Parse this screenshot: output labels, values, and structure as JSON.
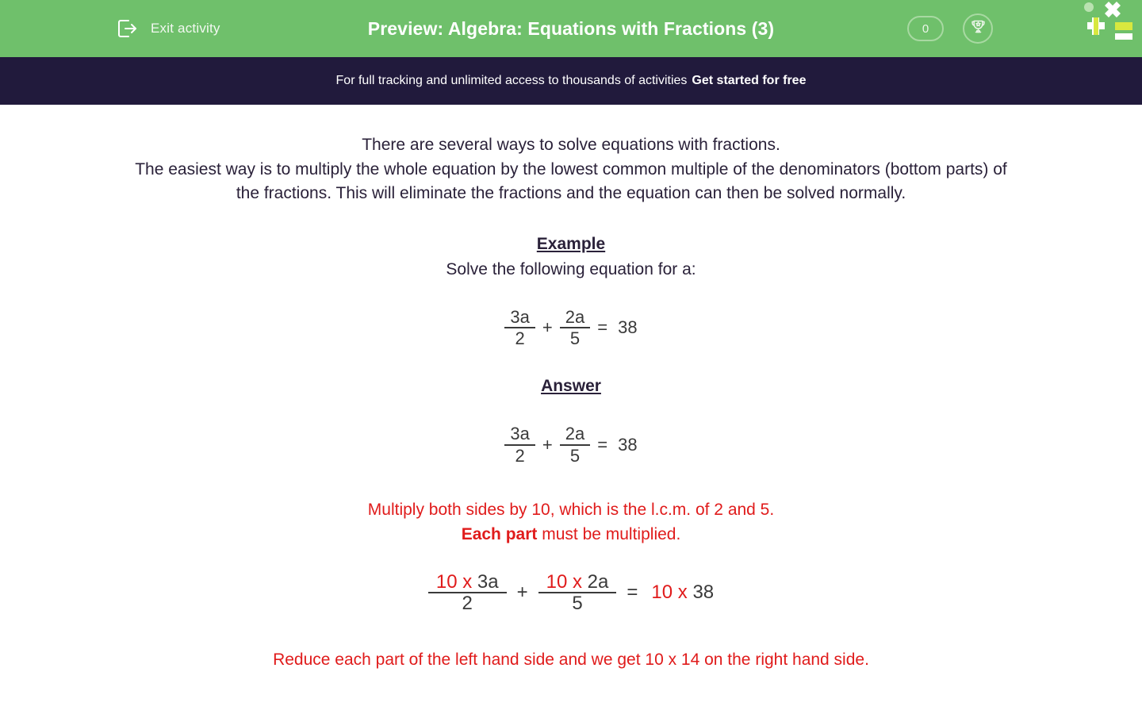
{
  "header": {
    "exit_label": "Exit activity",
    "exit_icon": "exit-arrow-icon",
    "title": "Preview: Algebra: Equations with Fractions (3)",
    "score": "0",
    "trophy_icon": "trophy-icon",
    "logo_name": "site-logo",
    "bg_color": "#6FC06B"
  },
  "promo": {
    "text": "For full tracking and unlimited access to thousands of activities",
    "link_label": "Get started for free",
    "bg_color": "#211A3C"
  },
  "content": {
    "intro_line_1": "There are several ways to solve equations with fractions.",
    "intro_line_2": "The easiest way is to multiply the whole equation by the lowest common multiple of the denominators (bottom parts) of the fractions.  This will eliminate the fractions and the equation can then be solved normally.",
    "example_heading": "Example",
    "example_prompt": "Solve the following equation for a:",
    "answer_heading": "Answer",
    "equation_1": {
      "frac_a_num": "3a",
      "frac_a_den": "2",
      "operator": "+",
      "frac_b_num": "2a",
      "frac_b_den": "5",
      "equals": "=",
      "rhs": "38"
    },
    "equation_2": {
      "frac_a_num": "3a",
      "frac_a_den": "2",
      "operator": "+",
      "frac_b_num": "2a",
      "frac_b_den": "5",
      "equals": "=",
      "rhs": "38"
    },
    "note_1_line_1": "Multiply both sides by 10, which is the l.c.m. of 2 and 5.",
    "note_1_bold": "Each part",
    "note_1_rest": " must be multiplied.",
    "equation_3": {
      "frac_a_num_red": "10 x",
      "frac_a_num_dark": "3a",
      "frac_a_den": "2",
      "operator": "+",
      "frac_b_num_red": "10 x",
      "frac_b_num_dark": "2a",
      "frac_b_den": "5",
      "equals": "=",
      "rhs_red": "10 x",
      "rhs_dark": "38"
    },
    "note_2": "Reduce each part of the left hand side and we get 10 x 14 on the right hand side.",
    "text_color": "#2A2139",
    "accent_red": "#E01B1B"
  }
}
